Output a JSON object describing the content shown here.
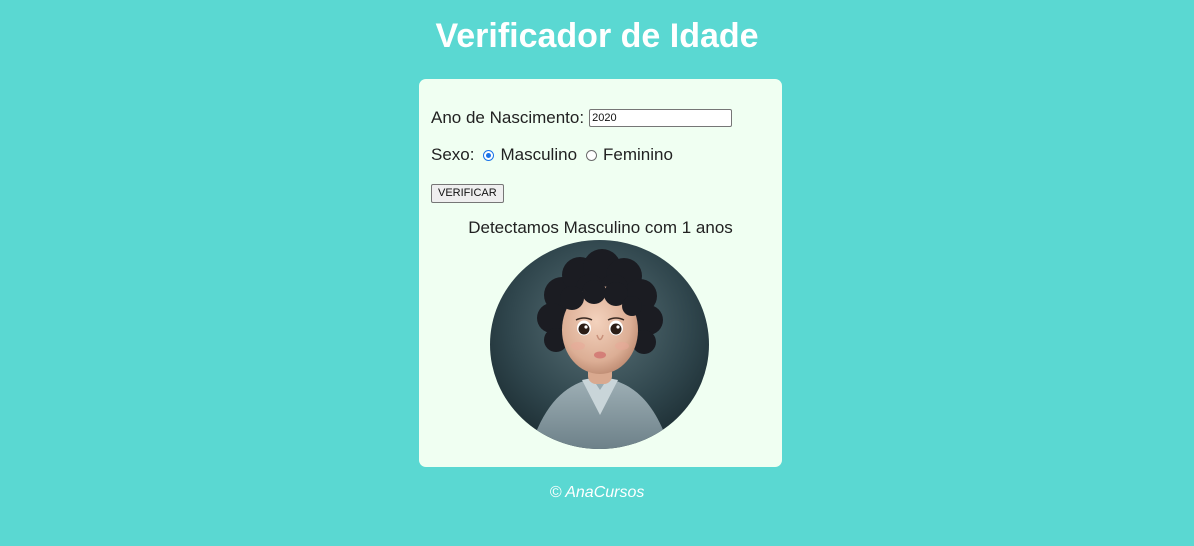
{
  "page": {
    "title": "Verificador de Idade",
    "footer": "© AnaCursos"
  },
  "form": {
    "year_label": "Ano de Nascimento:",
    "year_value": "2020",
    "sex_label": "Sexo:",
    "options": [
      {
        "label": "Masculino",
        "checked": true
      },
      {
        "label": "Feminino",
        "checked": false
      }
    ],
    "verify_label": "VERIFICAR"
  },
  "result": {
    "text": "Detectamos Masculino com 1 anos"
  },
  "colors": {
    "background": "#5ad8d2",
    "card": "#f0fff2",
    "accent": "#1a73e8"
  }
}
